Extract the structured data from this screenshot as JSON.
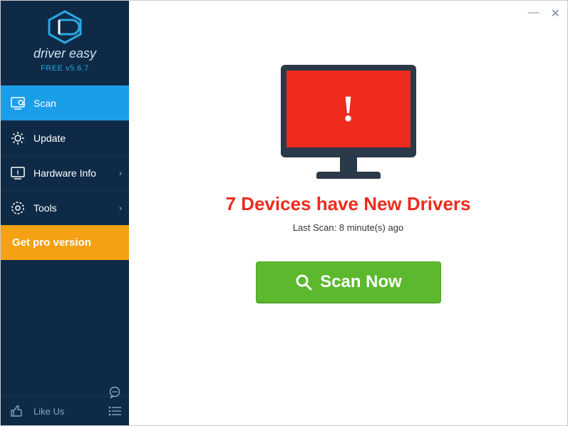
{
  "brand": {
    "name": "driver easy",
    "version": "FREE v5.6.7"
  },
  "sidebar": {
    "items": [
      {
        "label": "Scan"
      },
      {
        "label": "Update"
      },
      {
        "label": "Hardware Info"
      },
      {
        "label": "Tools"
      }
    ],
    "pro_button": "Get pro version",
    "footer": {
      "like_us": "Like Us"
    }
  },
  "main": {
    "headline": "7 Devices have New Drivers",
    "last_scan": "Last Scan: 8 minute(s) ago",
    "scan_button": "Scan Now"
  },
  "window_controls": {
    "minimize": "—",
    "close": "✕"
  }
}
